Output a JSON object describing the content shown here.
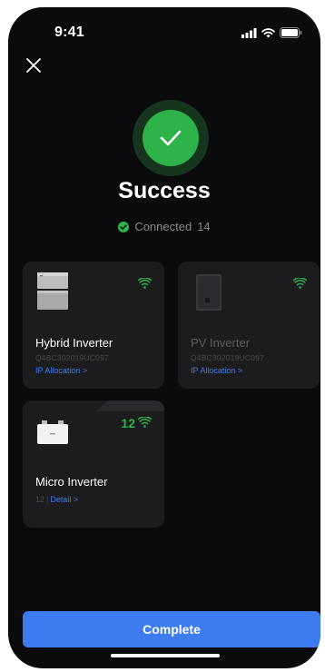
{
  "status_bar": {
    "time": "9:41"
  },
  "header": {
    "title": "Success",
    "connected_label": "Connected",
    "connected_count": "14"
  },
  "devices": [
    {
      "name": "Hybrid Inverter",
      "serial": "Q4BC302019UC097",
      "link": "IP Allocation >"
    },
    {
      "name": "PV Inverter",
      "serial": "Q4BC302019UC097",
      "link": "IP Allocation >"
    },
    {
      "name": "Micro Inverter",
      "count": "12",
      "link": "Detail >"
    }
  ],
  "footer": {
    "complete_label": "Complete"
  },
  "colors": {
    "background": "#0b0b0d",
    "card": "#1c1c1f",
    "success_green": "#2db34a",
    "accent_blue": "#3d7cf0"
  }
}
